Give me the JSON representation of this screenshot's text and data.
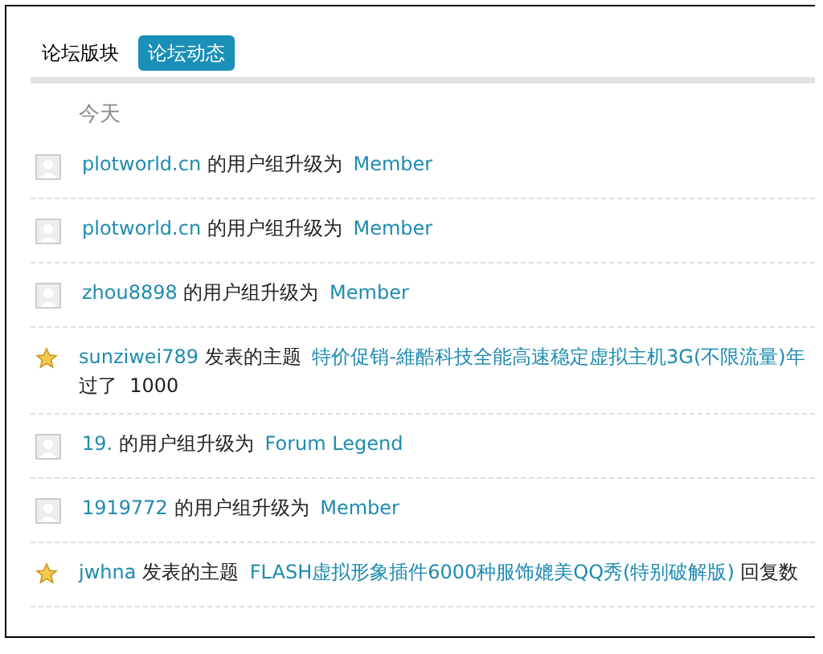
{
  "tabs": [
    {
      "label": "论坛版块",
      "selected": false
    },
    {
      "label": "论坛动态",
      "selected": true
    }
  ],
  "day": "今天",
  "feed": [
    {
      "kind": "upgrade",
      "user": "plotworld.cn",
      "action": "的用户组升级为",
      "target": "Member"
    },
    {
      "kind": "upgrade",
      "user": "plotworld.cn",
      "action": "的用户组升级为",
      "target": "Member"
    },
    {
      "kind": "upgrade",
      "user": "zhou8898",
      "action": "的用户组升级为",
      "target": "Member"
    },
    {
      "kind": "thread",
      "user": "sunziwei789",
      "action": "发表的主题",
      "target": "特价促销-維酷科技全能高速稳定虚拟主机3G(不限流量)年",
      "rest": "过了  1000"
    },
    {
      "kind": "upgrade",
      "user": "19.",
      "action": "的用户组升级为",
      "target": "Forum Legend"
    },
    {
      "kind": "upgrade",
      "user": "1919772",
      "action": "的用户组升级为",
      "target": "Member"
    },
    {
      "kind": "thread",
      "user": "jwhna",
      "action": "发表的主题",
      "target": "FLASH虚拟形象插件6000种服饰媲美QQ秀(特别破解版)",
      "tail": "回复数"
    }
  ]
}
